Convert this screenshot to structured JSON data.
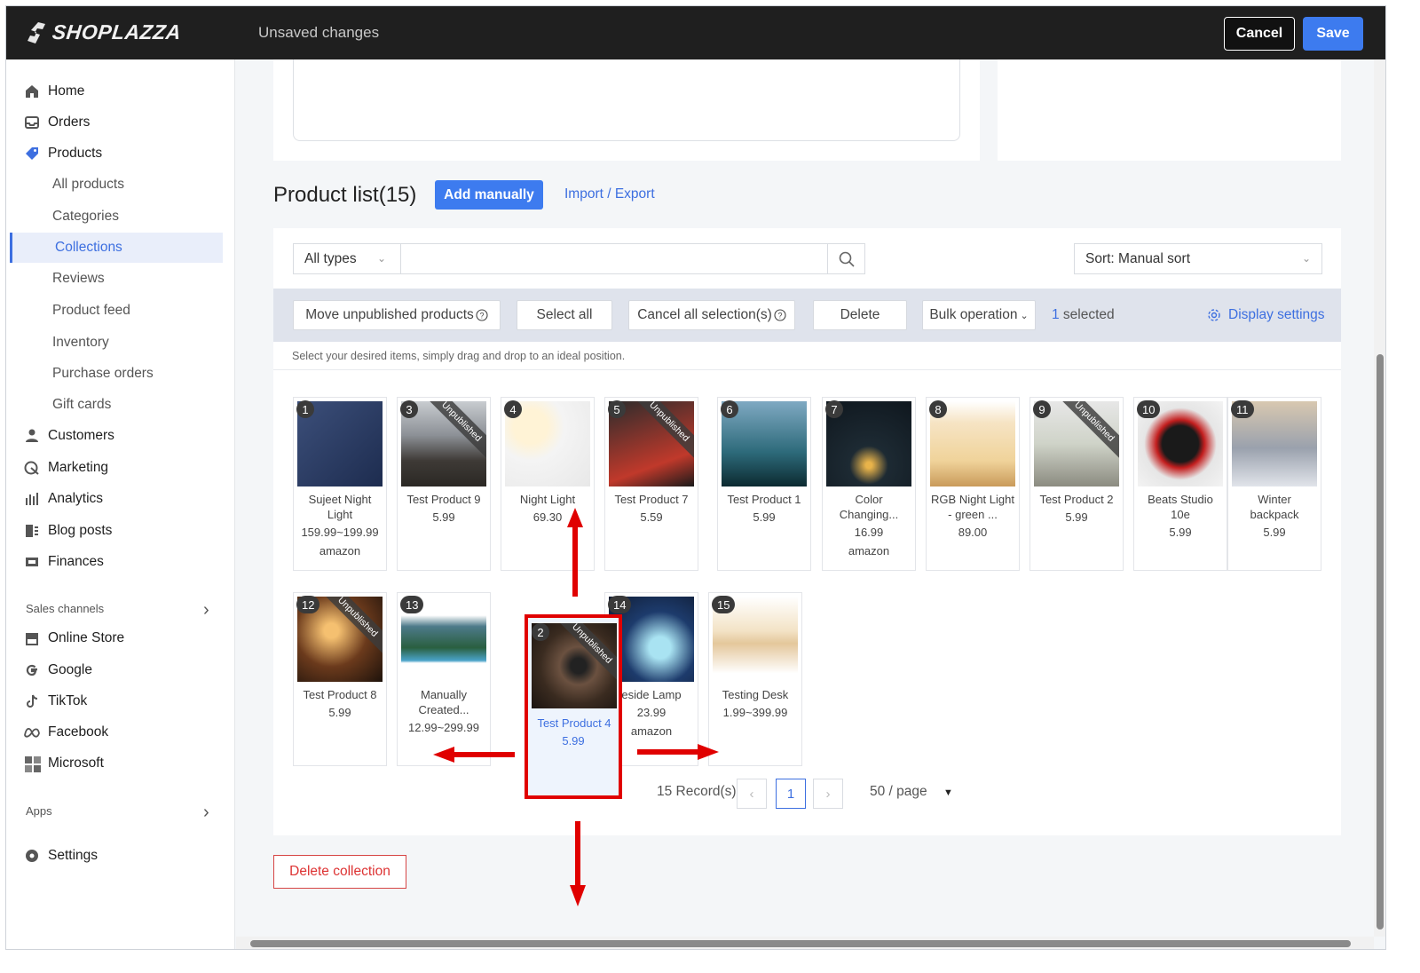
{
  "topbar": {
    "brand": "SHOPLAZZA",
    "status": "Unsaved changes",
    "cancel_label": "Cancel",
    "save_label": "Save"
  },
  "sidebar": {
    "items": [
      {
        "label": "Home",
        "icon": "home-icon"
      },
      {
        "label": "Orders",
        "icon": "inbox-icon"
      },
      {
        "label": "Products",
        "icon": "tag-icon"
      },
      {
        "label": "All products"
      },
      {
        "label": "Categories"
      },
      {
        "label": "Collections"
      },
      {
        "label": "Reviews"
      },
      {
        "label": "Product feed"
      },
      {
        "label": "Inventory"
      },
      {
        "label": "Purchase orders"
      },
      {
        "label": "Gift cards"
      },
      {
        "label": "Customers",
        "icon": "person-icon"
      },
      {
        "label": "Marketing",
        "icon": "megaphone-icon"
      },
      {
        "label": "Analytics",
        "icon": "bar-chart-icon"
      },
      {
        "label": "Blog posts",
        "icon": "blog-icon"
      },
      {
        "label": "Finances",
        "icon": "finance-icon"
      },
      {
        "label": "Online Store",
        "icon": "store-icon"
      },
      {
        "label": "Google",
        "icon": "google-icon"
      },
      {
        "label": "TikTok",
        "icon": "tiktok-icon"
      },
      {
        "label": "Facebook",
        "icon": "meta-icon"
      },
      {
        "label": "Microsoft",
        "icon": "microsoft-icon"
      },
      {
        "label": "Settings",
        "icon": "gear-icon"
      }
    ],
    "sales_channels": "Sales channels",
    "apps": "Apps"
  },
  "product_list": {
    "title": "Product list(15)",
    "add_manually": "Add manually",
    "import_export": "Import / Export",
    "type_filter": "All types",
    "sort": "Sort: Manual sort",
    "bulk_buttons": [
      "Move unpublished products",
      "Select all",
      "Cancel all selection(s)",
      "Delete",
      "Bulk operation"
    ],
    "selected_count": "1",
    "selected_label": " selected",
    "display_settings": "Display settings",
    "hint": "Select your desired items, simply drag and drop to an ideal position.",
    "unpublished_label": "Unpublished",
    "products": [
      {
        "num": "1",
        "name": "Sujeet Night Light",
        "price": "159.99~199.99",
        "extra": "amazon"
      },
      {
        "num": "3",
        "name": "Test Product 9",
        "price": "5.99",
        "unpublished": true
      },
      {
        "num": "4",
        "name": "Night Light",
        "price": "69.30"
      },
      {
        "num": "5",
        "name": "Test Product 7",
        "price": "5.59",
        "unpublished": true
      },
      {
        "num": "6",
        "name": "Test Product 1",
        "price": "5.99"
      },
      {
        "num": "7",
        "name": "Color Changing...",
        "price": "16.99",
        "extra": "amazon"
      },
      {
        "num": "8",
        "name": "RGB Night Light - green ...",
        "price": "89.00"
      },
      {
        "num": "9",
        "name": "Test Product 2",
        "price": "5.99",
        "unpublished": true
      },
      {
        "num": "10",
        "name": "Beats Studio 10e",
        "price": "5.99"
      },
      {
        "num": "11",
        "name": "Winter backpack",
        "price": "5.99"
      },
      {
        "num": "12",
        "name": "Test Product 8",
        "price": "5.99",
        "unpublished": true
      },
      {
        "num": "13",
        "name": "Manually Created...",
        "price": "12.99~299.99"
      },
      {
        "num": "14",
        "name": "eside Lamp",
        "price": "23.99",
        "extra": "amazon"
      },
      {
        "num": "15",
        "name": "Testing Desk",
        "price": "1.99~399.99"
      }
    ],
    "dragged": {
      "num": "2",
      "name": "Test Product 4",
      "price": "5.99",
      "unpublished": true
    },
    "pagination": {
      "records": "15 Record(s)",
      "page": "1",
      "per_page": "50 / page"
    },
    "delete_collection": "Delete collection"
  },
  "colors": {
    "accent": "#3d7bef",
    "danger": "#e00000",
    "topbar": "#1f1f1f"
  }
}
